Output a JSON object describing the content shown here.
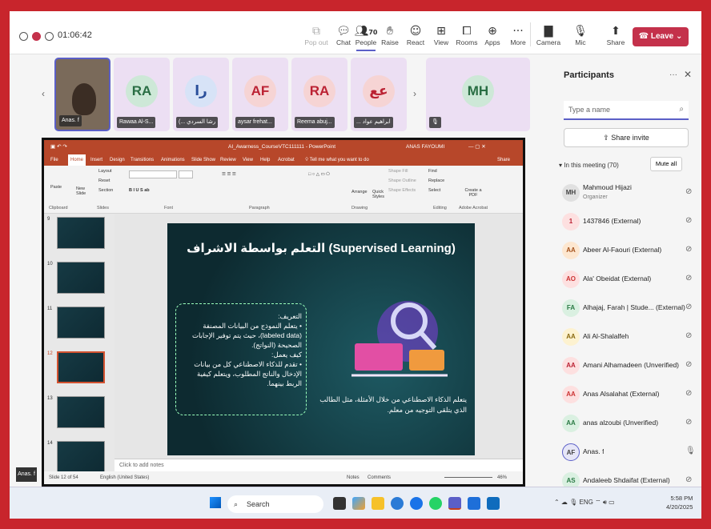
{
  "meeting": {
    "timer": "01:06:42",
    "people_count": "70"
  },
  "toolbar": {
    "popout": "Pop out",
    "chat": "Chat",
    "people": "People",
    "raise": "Raise",
    "react": "React",
    "view": "View",
    "rooms": "Rooms",
    "apps": "Apps",
    "more": "More",
    "camera": "Camera",
    "mic": "Mic",
    "share": "Share",
    "leave": "Leave"
  },
  "tiles": [
    {
      "initials": "",
      "name": "Anas. f"
    },
    {
      "initials": "RA",
      "name": "Rawaa Al-S..."
    },
    {
      "initials": "را",
      "name": "(... رشا السردي"
    },
    {
      "initials": "AF",
      "name": "aysar frehat..."
    },
    {
      "initials": "RA",
      "name": "Reema abuj..."
    },
    {
      "initials": "عع",
      "name": "... ابراهيم عواد"
    },
    {
      "initials": "MH",
      "name": ""
    }
  ],
  "ppt": {
    "filename": "AI_Awarness_CourseVTC111111  -  PowerPoint",
    "user": "ANAS FAYOUMI",
    "tellme": "Tell me what you want to do",
    "share": "Share",
    "tabs": [
      "File",
      "Home",
      "Insert",
      "Design",
      "Transitions",
      "Animations",
      "Slide Show",
      "Review",
      "View",
      "Help",
      "Acrobat"
    ],
    "groups": [
      "Clipboard",
      "Slides",
      "Font",
      "Paragraph",
      "Drawing",
      "Editing",
      "Adobe Acrobat"
    ],
    "ribbon": {
      "paste": "Paste",
      "new_slide": "New Slide",
      "layout": "Layout",
      "reset": "Reset",
      "section": "Section",
      "arrange": "Arrange",
      "quick_styles": "Quick Styles",
      "shape_fill": "Shape Fill",
      "shape_outline": "Shape Outline",
      "shape_effects": "Shape Effects",
      "find": "Find",
      "replace": "Replace",
      "select": "Select",
      "create_pdf": "Create a PDF"
    },
    "thumb_numbers": [
      "9",
      "10",
      "11",
      "12",
      "13",
      "14"
    ],
    "notes": "Click to add notes",
    "status": {
      "slide": "Slide 12 of 54",
      "language": "English (United States)",
      "notes": "Notes",
      "comments": "Comments",
      "zoom": "46%"
    },
    "slide": {
      "title": "التعلم بواسطة الاشراف (Supervised Learning)",
      "definition": "التعريف:\n• يتعلم النموذج من البيانات المصنفة (labeled data)، حيث يتم توفير الإجابات الصحيحة (النواتج).\nكيف يعمل:\n• تقدم للذكاء الاصطناعي كل من بيانات الإدخال والناتج المطلوب، ويتعلم كيفية الربط بينهما.",
      "side": "يتعلم الذكاء الاصطناعي من خلال الأمثلة، مثل الطالب الذي يتلقى التوجيه من معلم."
    }
  },
  "self_label": "Anas. f",
  "participants": {
    "title": "Participants",
    "search_placeholder": "Type a name",
    "invite": "Share invite",
    "in_meeting": "In this meeting (70)",
    "mute_all": "Mute all",
    "list": [
      {
        "initials": "MH",
        "name": "Mahmoud Hijazi",
        "role": "Organizer",
        "color": "#e0e0e0",
        "fg": "#444",
        "mic": "off"
      },
      {
        "initials": "1",
        "name": "1437846 (External)",
        "role": "",
        "color": "#fde0e0",
        "fg": "#b23",
        "mic": "off"
      },
      {
        "initials": "AA",
        "name": "Abeer Al-Faouri (External)",
        "role": "",
        "color": "#fde7d0",
        "fg": "#a5521c",
        "mic": "off"
      },
      {
        "initials": "AO",
        "name": "Ala' Obeidat (External)",
        "role": "",
        "color": "#fde0e0",
        "fg": "#c33",
        "mic": "off"
      },
      {
        "initials": "FA",
        "name": "Alhajaj, Farah | Stude... (External)",
        "role": "",
        "color": "#daf0e1",
        "fg": "#2a7a44",
        "mic": "off"
      },
      {
        "initials": "AA",
        "name": "Ali Al-Shalalfeh",
        "role": "",
        "color": "#fdf2d0",
        "fg": "#8a6a10",
        "mic": "off"
      },
      {
        "initials": "AA",
        "name": "Amani Alhamadeen (Unverified)",
        "role": "",
        "color": "#fde0e0",
        "fg": "#b23",
        "mic": "off"
      },
      {
        "initials": "AA",
        "name": "Anas Alsalahat (External)",
        "role": "",
        "color": "#fde0e0",
        "fg": "#c33",
        "mic": "off"
      },
      {
        "initials": "AA",
        "name": "anas alzoubi (Unverified)",
        "role": "",
        "color": "#daf0e1",
        "fg": "#2a7a44",
        "mic": "off"
      },
      {
        "initials": "AF",
        "name": "Anas. f",
        "role": "",
        "color": "#e6e6f7",
        "fg": "#444",
        "mic": "on"
      },
      {
        "initials": "AS",
        "name": "Andaleeb Shdaifat (External)",
        "role": "",
        "color": "#daf0e1",
        "fg": "#2a7a44",
        "mic": "off"
      }
    ]
  },
  "taskbar": {
    "search": "Search",
    "lang": "ENG",
    "time": "5:58 PM",
    "date": "4/20/2025"
  }
}
